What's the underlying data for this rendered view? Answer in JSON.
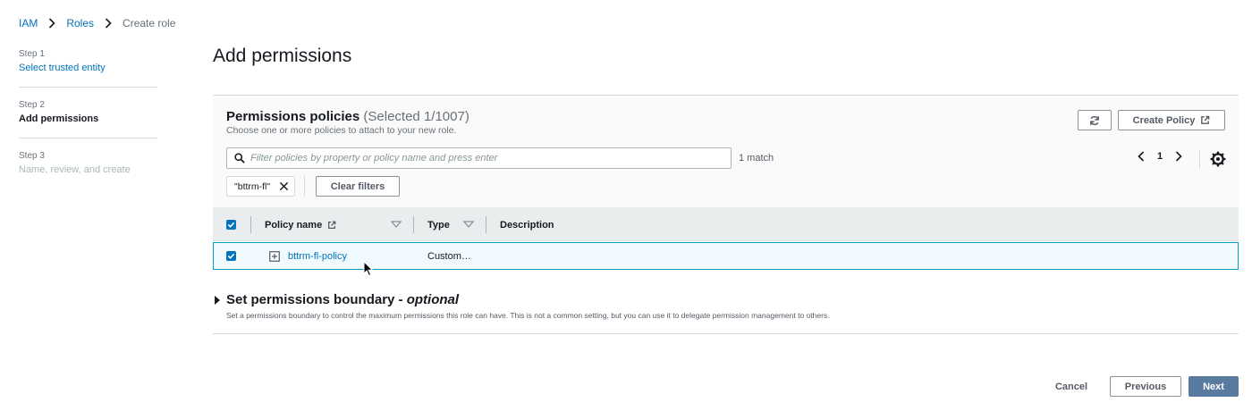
{
  "breadcrumb": {
    "items": [
      "IAM",
      "Roles"
    ],
    "current": "Create role"
  },
  "steps": [
    {
      "num": "Step 1",
      "label": "Select trusted entity",
      "state": "link"
    },
    {
      "num": "Step 2",
      "label": "Add permissions",
      "state": "active"
    },
    {
      "num": "Step 3",
      "label": "Name, review, and create",
      "state": "disabled"
    }
  ],
  "page_title": "Add permissions",
  "permissions": {
    "title": "Permissions policies",
    "counter": "(Selected 1/1007)",
    "description": "Choose one or more policies to attach to your new role.",
    "create_policy_label": "Create Policy",
    "search_placeholder": "Filter policies by property or policy name and press enter",
    "match_text": "1 match",
    "page_number": "1",
    "filter_token": "\"bttrm-fl\"",
    "clear_filters_label": "Clear filters",
    "columns": {
      "policy_name": "Policy name",
      "type": "Type",
      "description": "Description"
    },
    "rows": [
      {
        "policy_name": "bttrm-fl-policy",
        "type": "Custom…",
        "description": "",
        "selected": true
      }
    ]
  },
  "boundary": {
    "title": "Set permissions boundary - ",
    "title_optional": "optional",
    "description": "Set a permissions boundary to control the maximum permissions this role can have. This is not a common setting, but you can use it to delegate permission management to others."
  },
  "footer": {
    "cancel_label": "Cancel",
    "previous_label": "Previous",
    "next_label": "Next"
  },
  "colors": {
    "link": "#0073bb",
    "primary_button": "#5a7ba0",
    "selected_row_bg": "#f1faff",
    "selected_row_border": "#00a1c9"
  },
  "icons": [
    "chevron-right-icon",
    "refresh-icon",
    "external-link-icon",
    "search-icon",
    "chevron-left-icon",
    "gear-icon",
    "close-icon",
    "checkbox-checked-icon",
    "sort-down-icon",
    "expand-plus-icon",
    "caret-right-icon",
    "mouse-cursor-icon"
  ]
}
